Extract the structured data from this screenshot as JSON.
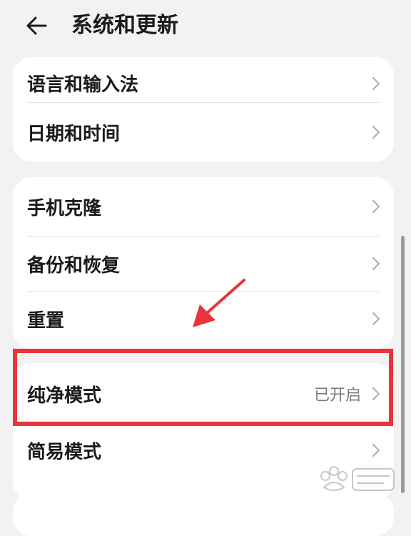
{
  "header": {
    "title": "系统和更新",
    "back_icon": "arrow-left-icon"
  },
  "groups": [
    {
      "items": [
        {
          "label": "语言和输入法",
          "value": ""
        },
        {
          "label": "日期和时间",
          "value": ""
        }
      ]
    },
    {
      "items": [
        {
          "label": "手机克隆",
          "value": ""
        },
        {
          "label": "备份和恢复",
          "value": ""
        },
        {
          "label": "重置",
          "value": ""
        }
      ]
    },
    {
      "items": [
        {
          "label": "纯净模式",
          "value": "已开启"
        },
        {
          "label": "简易模式",
          "value": ""
        }
      ]
    }
  ],
  "annotation": {
    "highlight_color": "#e8343a",
    "highlighted_item": "纯净模式"
  },
  "colors": {
    "background": "#f2f2f2",
    "card": "#ffffff",
    "text": "#1a1a1a",
    "secondary_text": "#7a7a7a",
    "chevron": "#b0b0b0"
  }
}
